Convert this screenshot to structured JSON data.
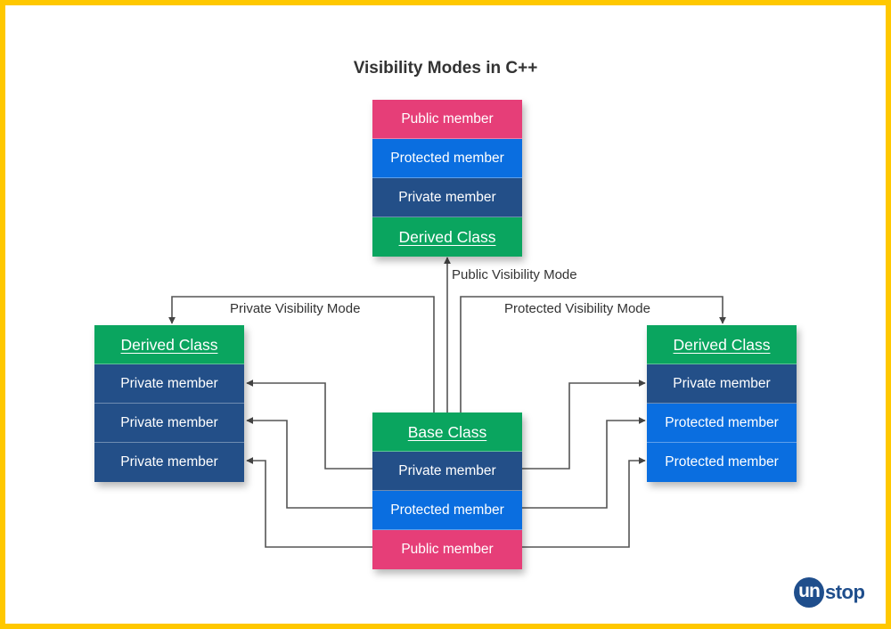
{
  "title": "Visibility Modes in C++",
  "colors": {
    "border": "#ffc800",
    "class_header": "#0aa55f",
    "public": "#e63e78",
    "protected": "#0a6ee0",
    "private": "#234f88",
    "connector": "#444444",
    "logo": "#1f4e8c"
  },
  "boxes": {
    "public_derived": {
      "rows": [
        {
          "label": "Public member",
          "kind": "public"
        },
        {
          "label": "Protected member",
          "kind": "protected"
        },
        {
          "label": "Private member",
          "kind": "private"
        },
        {
          "label": "Derived Class",
          "kind": "header"
        }
      ]
    },
    "private_derived": {
      "rows": [
        {
          "label": "Derived Class",
          "kind": "header"
        },
        {
          "label": "Private member",
          "kind": "private"
        },
        {
          "label": "Private member",
          "kind": "private"
        },
        {
          "label": "Private member",
          "kind": "private"
        }
      ]
    },
    "protected_derived": {
      "rows": [
        {
          "label": "Derived Class",
          "kind": "header"
        },
        {
          "label": "Private member",
          "kind": "private"
        },
        {
          "label": "Protected member",
          "kind": "protected"
        },
        {
          "label": "Protected member",
          "kind": "protected"
        }
      ]
    },
    "base": {
      "rows": [
        {
          "label": "Base Class",
          "kind": "header"
        },
        {
          "label": "Private member",
          "kind": "private"
        },
        {
          "label": "Protected member",
          "kind": "protected"
        },
        {
          "label": "Public member",
          "kind": "public"
        }
      ]
    }
  },
  "edges": [
    {
      "from": "base",
      "to": "public_derived",
      "label": "Public Visibility Mode"
    },
    {
      "from": "base",
      "to": "private_derived",
      "label": "Private Visibility Mode"
    },
    {
      "from": "base",
      "to": "protected_derived",
      "label": "Protected Visibility Mode"
    },
    {
      "from": "base.private",
      "to": "private_derived.row1"
    },
    {
      "from": "base.protected",
      "to": "private_derived.row2"
    },
    {
      "from": "base.public",
      "to": "private_derived.row3"
    },
    {
      "from": "base.private",
      "to": "protected_derived.row1"
    },
    {
      "from": "base.protected",
      "to": "protected_derived.row2"
    },
    {
      "from": "base.public",
      "to": "protected_derived.row3"
    }
  ],
  "labels": {
    "public_mode": "Public Visibility Mode",
    "private_mode": "Private Visibility Mode",
    "protected_mode": "Protected Visibility Mode"
  },
  "logo": {
    "circle_text": "un",
    "rest_text": "stop"
  }
}
